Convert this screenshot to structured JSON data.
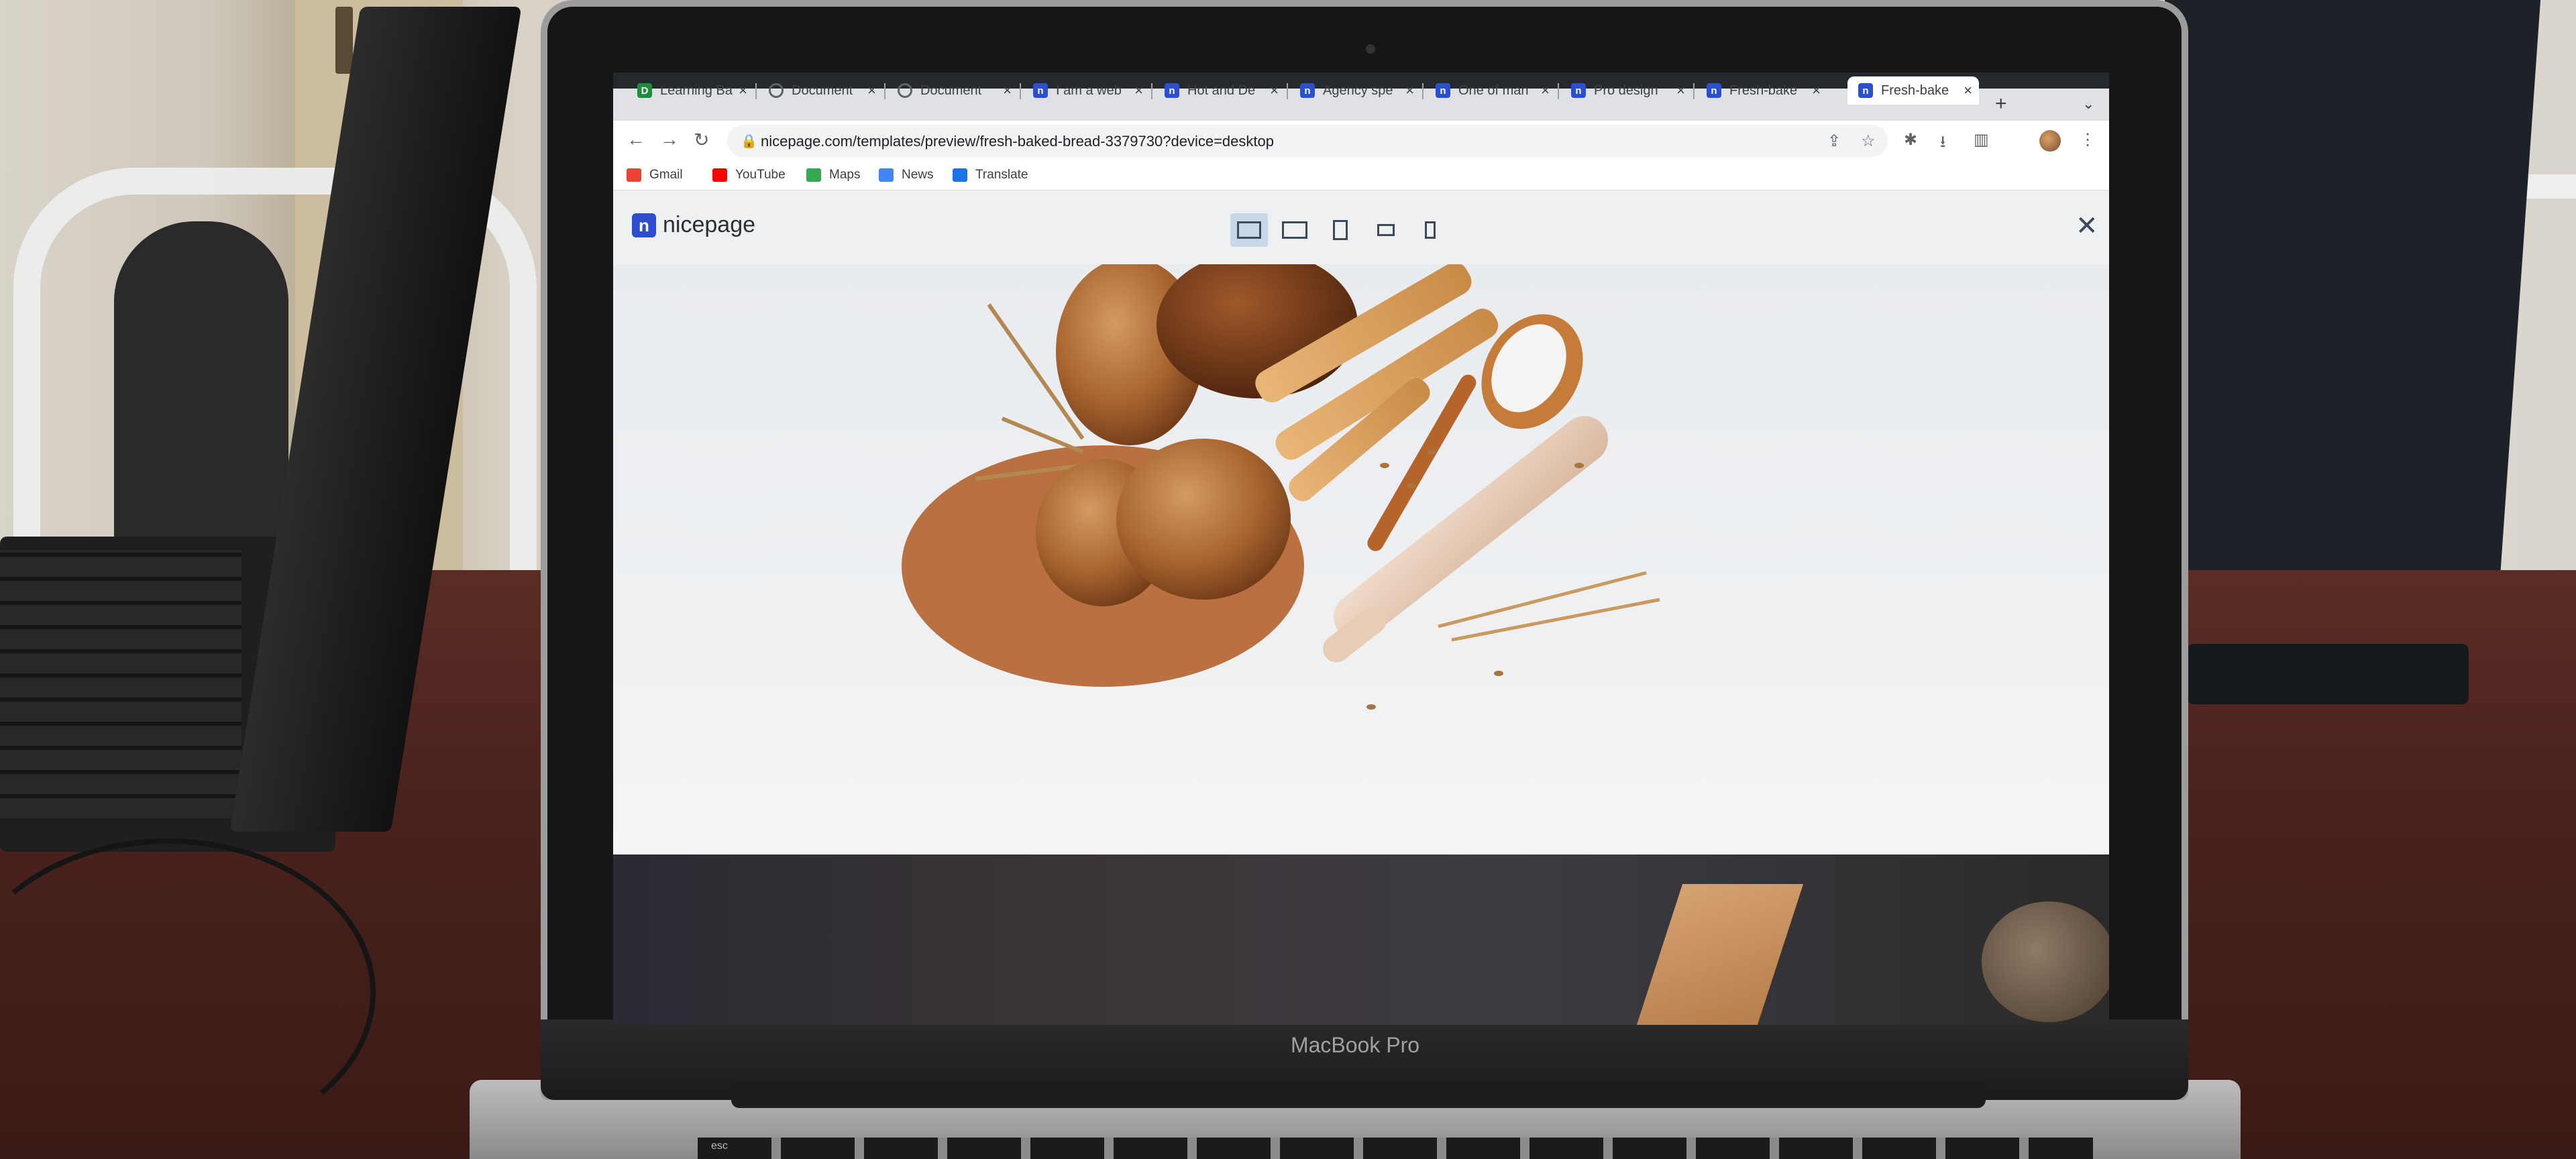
{
  "browser": {
    "tabs": [
      {
        "label": "Learning Ba",
        "icon": "document-favicon-icon"
      },
      {
        "label": "Document",
        "icon": "globe-icon"
      },
      {
        "label": "Document",
        "icon": "globe-icon"
      },
      {
        "label": "I am a web",
        "icon": "nicepage-favicon-icon"
      },
      {
        "label": "Hot and De",
        "icon": "nicepage-favicon-icon"
      },
      {
        "label": "Agency spe",
        "icon": "nicepage-favicon-icon"
      },
      {
        "label": "One of man",
        "icon": "nicepage-favicon-icon"
      },
      {
        "label": "Pro design",
        "icon": "nicepage-favicon-icon"
      },
      {
        "label": "Fresh-bake",
        "icon": "nicepage-favicon-icon"
      },
      {
        "label": "Fresh-bake",
        "icon": "nicepage-favicon-icon",
        "active": true
      }
    ],
    "url": "nicepage.com/templates/preview/fresh-baked-bread-3379730?device=desktop",
    "bookmarks": [
      {
        "label": "Gmail",
        "icon": "gmail-icon"
      },
      {
        "label": "YouTube",
        "icon": "youtube-icon"
      },
      {
        "label": "Maps",
        "icon": "maps-icon"
      },
      {
        "label": "News",
        "icon": "news-icon"
      },
      {
        "label": "Translate",
        "icon": "translate-icon"
      }
    ]
  },
  "nicepage": {
    "logo_text": "nicepage",
    "devices": [
      "desktop",
      "laptop",
      "tablet",
      "phone-landscape",
      "phone"
    ],
    "active_device": "desktop"
  },
  "laptop": {
    "label": "MacBook Pro",
    "esc_key": "esc"
  },
  "colors": {
    "nicepage_blue": "#2b4fcf",
    "preview_bg": "#eef0f2",
    "device_active": "#c9d6e8"
  }
}
